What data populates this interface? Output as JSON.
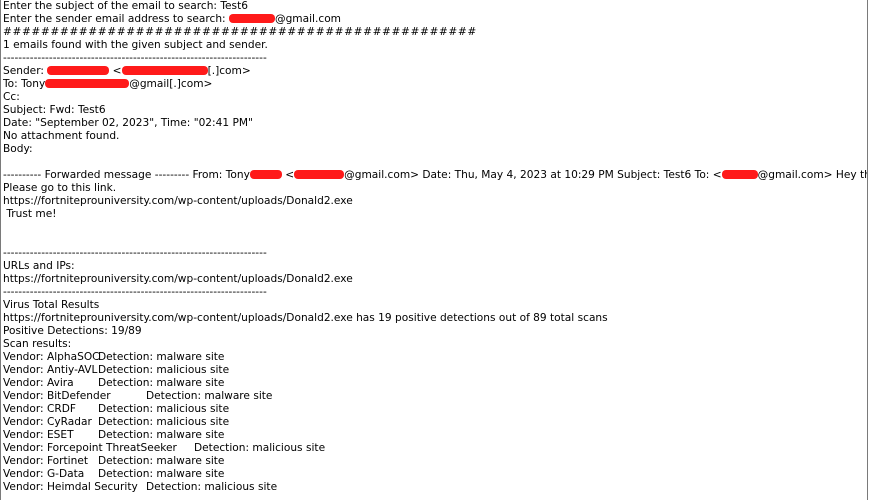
{
  "prompts": {
    "subject_line": "Enter the subject of the email to search: Test6",
    "sender_prefix": "Enter the sender email address to search: ",
    "sender_suffix": "@gmail.com"
  },
  "hash_line": "##################################################",
  "found_line": "1 emails found with the given subject and sender.",
  "separator": "---------------------------------------------------------------------",
  "header": {
    "sender_prefix": "Sender: ",
    "sender_suffix": "[.]com>",
    "to_prefix": "To: Tony",
    "to_suffix": "@gmail[.]com>",
    "cc": "Cc:",
    "subject": "Subject: Fwd: Test6",
    "date": "Date: \"September 02, 2023\", Time: \"02:41 PM\"",
    "attachment": "No attachment found.",
    "body_label": "Body:"
  },
  "body": {
    "forward_prefix": "---------- Forwarded message --------- From: Tony",
    "forward_mid1": "@gmail.com> Date: Thu, May 4, 2023 at 10:29 PM Subject: Test6 To: <",
    "forward_mid2": "@gmail.com> Hey this is a test.",
    "line2": "Please go to this link.",
    "link": "https://fortniteprouniversity.com/wp-content/uploads/Donald2.exe",
    "trust": " Trust me!"
  },
  "urls": {
    "label": "URLs and IPs:",
    "item": "https://fortniteprouniversity.com/wp-content/uploads/Donald2.exe"
  },
  "virus_total": {
    "title": "Virus Total Results",
    "summary": "https://fortniteprouniversity.com/wp-content/uploads/Donald2.exe has 19 positive detections out of 89 total scans",
    "positive": "Positive Detections: 19/89",
    "scan_label": "Scan results:",
    "rows": [
      {
        "vendor": "Vendor: AlphaSOC",
        "detection": "Detection: malware site"
      },
      {
        "vendor": "Vendor: Antiy-AVL",
        "detection": "Detection: malicious site"
      },
      {
        "vendor": "Vendor: Avira",
        "detection": "Detection: malware site"
      },
      {
        "vendor": "Vendor: BitDefender",
        "detection": "Detection: malware site"
      },
      {
        "vendor": "Vendor: CRDF",
        "detection": "Detection: malicious site"
      },
      {
        "vendor": "Vendor: CyRadar",
        "detection": "Detection: malicious site"
      },
      {
        "vendor": "Vendor: ESET",
        "detection": "Detection: malware site"
      },
      {
        "vendor": "Vendor: Forcepoint ThreatSeeker",
        "detection": "Detection: malicious site"
      },
      {
        "vendor": "Vendor: Fortinet",
        "detection": "Detection: malware site"
      },
      {
        "vendor": "Vendor: G-Data",
        "detection": "Detection: malware site"
      },
      {
        "vendor": "Vendor: Heimdal Security",
        "detection": "Detection: malicious site"
      }
    ]
  }
}
